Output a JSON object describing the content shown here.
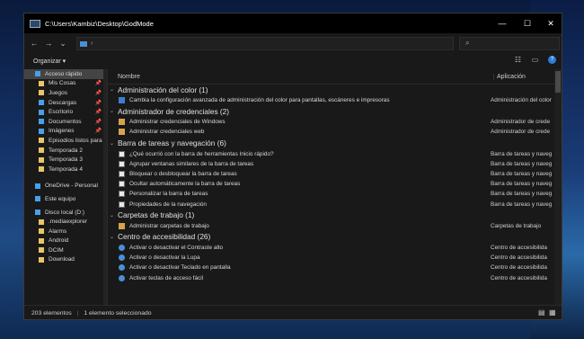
{
  "window": {
    "title": "C:\\Users\\Kambiz\\Desktop\\GodMode",
    "controls": {
      "minimize": "—",
      "maximize": "☐",
      "close": "✕"
    }
  },
  "nav": {
    "back": "←",
    "forward": "→",
    "dropdown": "⌄",
    "up": "↑",
    "address_chevron": "›",
    "search_placeholder": ""
  },
  "toolbar": {
    "organize": "Organizar ▾"
  },
  "columns": {
    "name": "Nombre",
    "app": "Aplicación"
  },
  "sidebar": {
    "items": [
      {
        "label": "Acceso rápido",
        "icon": "star-icon",
        "pinned": false,
        "selected": true
      },
      {
        "label": "Mis Cosas",
        "icon": "folder-icon",
        "pinned": true
      },
      {
        "label": "Juegos",
        "icon": "folder-icon",
        "pinned": true
      },
      {
        "label": "Descargas",
        "icon": "download-icon",
        "pinned": true
      },
      {
        "label": "Escritorio",
        "icon": "desktop-icon",
        "pinned": true
      },
      {
        "label": "Documentos",
        "icon": "documents-icon",
        "pinned": true
      },
      {
        "label": "Imágenes",
        "icon": "images-icon",
        "pinned": true
      },
      {
        "label": "Episodios listos para",
        "icon": "folder-icon",
        "pinned": false
      },
      {
        "label": "Temporada 2",
        "icon": "folder-icon",
        "pinned": false
      },
      {
        "label": "Temporada 3",
        "icon": "folder-icon",
        "pinned": false
      },
      {
        "label": "Temporada 4",
        "icon": "folder-icon",
        "pinned": false
      },
      {
        "label": "OneDrive - Personal",
        "icon": "cloud-icon",
        "pinned": false
      },
      {
        "label": "Este equipo",
        "icon": "computer-icon",
        "pinned": false
      },
      {
        "label": "Disco local (D:)",
        "icon": "drive-icon",
        "pinned": false
      },
      {
        "label": ".mediaexplorer",
        "icon": "folder-icon",
        "pinned": false
      },
      {
        "label": "Alarms",
        "icon": "folder-icon",
        "pinned": false
      },
      {
        "label": "Android",
        "icon": "folder-icon",
        "pinned": false
      },
      {
        "label": "DCIM",
        "icon": "folder-icon",
        "pinned": false
      },
      {
        "label": "Download",
        "icon": "folder-icon",
        "pinned": false
      }
    ]
  },
  "groups": [
    {
      "title": "Administración del color (1)",
      "rows": [
        {
          "label": "Cambia la configuración avanzada de administración del color para pantallas, escáneres e impresoras",
          "app": "Administración del color",
          "icon": "color-icon"
        }
      ]
    },
    {
      "title": "Administrador de credenciales (2)",
      "rows": [
        {
          "label": "Administrar credenciales de Windows",
          "app": "Administrador de crede",
          "icon": "credentials-icon"
        },
        {
          "label": "Administrar credenciales web",
          "app": "Administrador de crede",
          "icon": "credentials-icon"
        }
      ]
    },
    {
      "title": "Barra de tareas y navegación (6)",
      "rows": [
        {
          "label": "¿Qué ocurrió con la barra de herramientas Inicio rápido?",
          "app": "Barra de tareas y naveg",
          "icon": "taskbar-icon"
        },
        {
          "label": "Agrupar ventanas similares de la barra de tareas",
          "app": "Barra de tareas y naveg",
          "icon": "taskbar-icon"
        },
        {
          "label": "Bloquear o desbloquear la barra de tareas",
          "app": "Barra de tareas y naveg",
          "icon": "taskbar-icon"
        },
        {
          "label": "Ocultar automáticamente la barra de tareas",
          "app": "Barra de tareas y naveg",
          "icon": "taskbar-icon"
        },
        {
          "label": "Personalizar la barra de tareas",
          "app": "Barra de tareas y naveg",
          "icon": "taskbar-icon"
        },
        {
          "label": "Propiedades de la navegación",
          "app": "Barra de tareas y naveg",
          "icon": "taskbar-icon"
        }
      ]
    },
    {
      "title": "Carpetas de trabajo (1)",
      "rows": [
        {
          "label": "Administrar carpetas de trabajo",
          "app": "Carpetas de trabajo",
          "icon": "work-folders-icon"
        }
      ]
    },
    {
      "title": "Centro de accesibilidad (26)",
      "rows": [
        {
          "label": "Activar o desactivar el Contraste alto",
          "app": "Centro de accesibilida",
          "icon": "accessibility-icon"
        },
        {
          "label": "Activar o desactivar la Lupa",
          "app": "Centro de accesibilida",
          "icon": "accessibility-icon"
        },
        {
          "label": "Activar o desactivar Teclado en pantalla",
          "app": "Centro de accesibilida",
          "icon": "accessibility-icon"
        },
        {
          "label": "Activar teclas de acceso fácil",
          "app": "Centro de accesibilida",
          "icon": "accessibility-icon"
        }
      ]
    }
  ],
  "status": {
    "count": "203 elementos",
    "selection": "1 elemento seleccionado"
  }
}
